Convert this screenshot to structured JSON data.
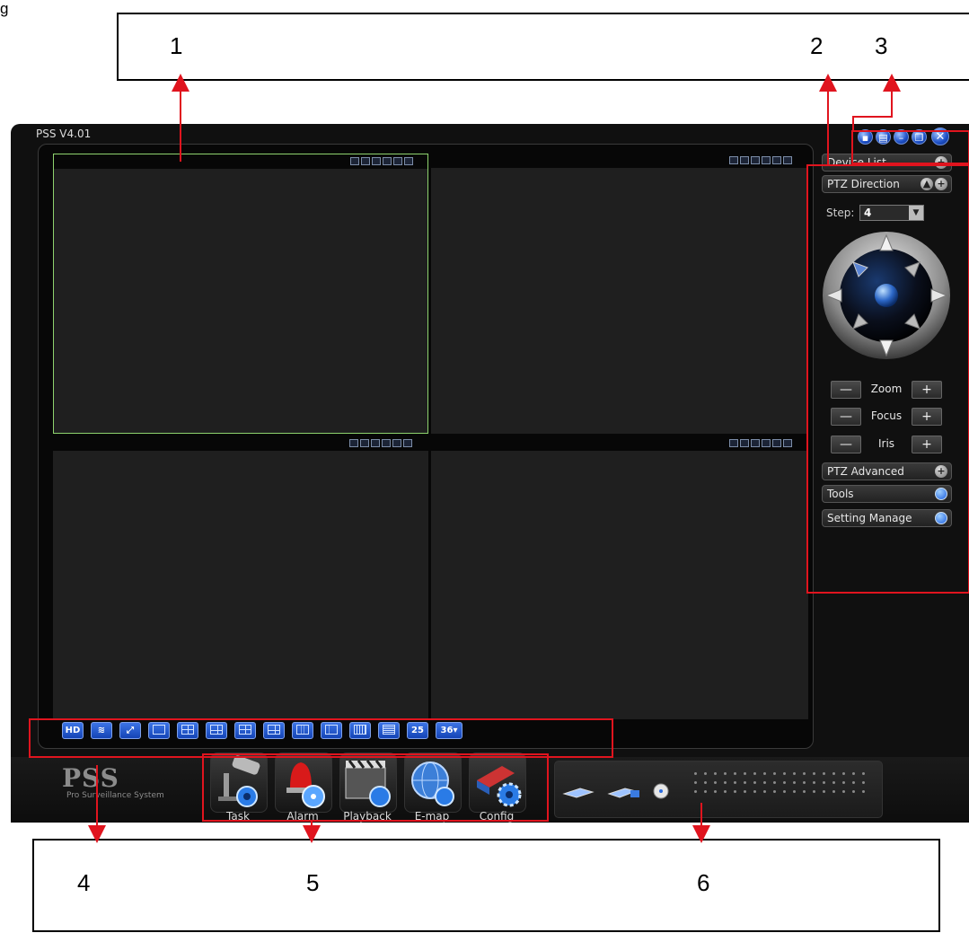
{
  "figure_fragment": "g",
  "callouts": {
    "top_numbers": [
      "1",
      "2",
      "3"
    ],
    "bottom_numbers": [
      "4",
      "5",
      "6"
    ]
  },
  "window": {
    "title": "PSS  V4.01",
    "controls": [
      "lock",
      "config",
      "minimize",
      "restore",
      "close"
    ]
  },
  "video_toolbar": {
    "buttons": [
      "HD",
      "sequence",
      "fullscreen",
      "1-split",
      "4-split",
      "6-split",
      "8-split",
      "9-split-a",
      "9-split",
      "13-split",
      "16-split",
      "20-split",
      "25",
      "36▾"
    ]
  },
  "right_panel": {
    "device_list": "Device List",
    "ptz_direction": "PTZ Direction",
    "step_label": "Step:",
    "step_value": "4",
    "zoom": "Zoom",
    "focus": "Focus",
    "iris": "Iris",
    "minus": "—",
    "plus": "+",
    "ptz_advanced": "PTZ Advanced",
    "tools": "Tools",
    "setting_manage": "Setting Manage"
  },
  "logo": {
    "main": "PSS",
    "sub": "Pro Surveillance System"
  },
  "modules": [
    {
      "label": "Task",
      "icon": "camera-icon"
    },
    {
      "label": "Alarm",
      "icon": "siren-icon"
    },
    {
      "label": "Playback",
      "icon": "clapperboard-icon"
    },
    {
      "label": "E-map",
      "icon": "globe-icon"
    },
    {
      "label": "Config",
      "icon": "settings-icon"
    }
  ],
  "colors": {
    "callout_red": "#e0141e",
    "active_pane_border": "#8ed36e",
    "toolbar_blue": "#1f55cf"
  }
}
